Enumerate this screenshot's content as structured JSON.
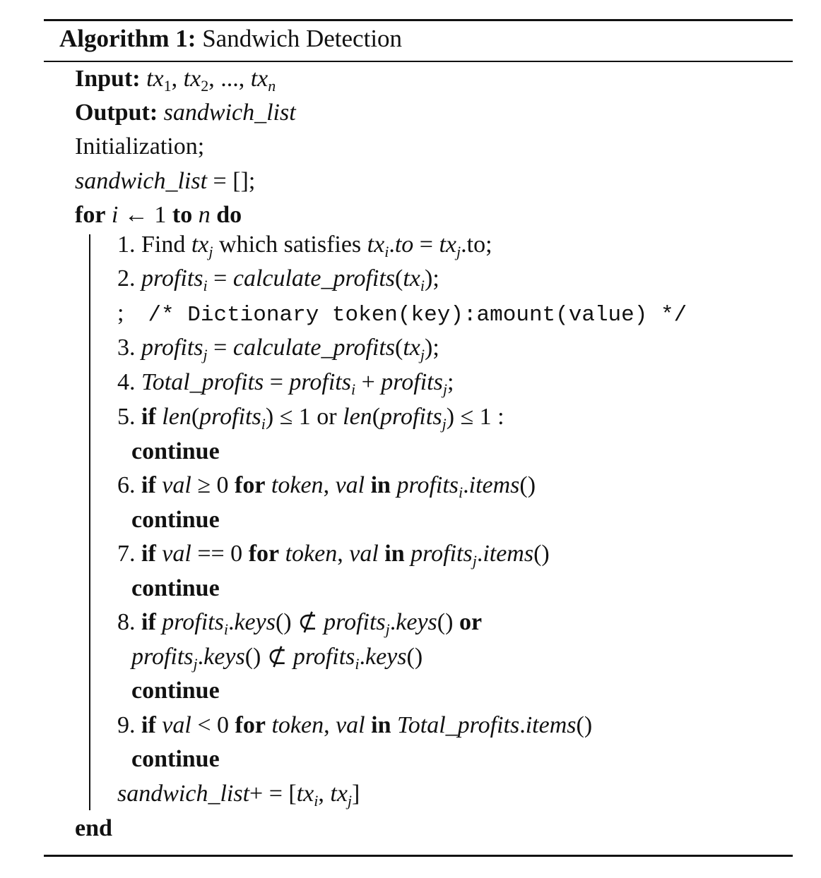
{
  "caption": {
    "label": "Algorithm 1:",
    "title": "Sandwich Detection"
  },
  "io": {
    "input_label": "Input:",
    "input_value": "tx1, tx2, ..., txn",
    "output_label": "Output:",
    "output_value": "sandwich_list"
  },
  "init": {
    "initialization": "Initialization;",
    "assign": "sandwich_list = [];"
  },
  "loop": {
    "header": "for i ← 1 to n do",
    "end": "end"
  },
  "steps": [
    "1. Find txj which satisfies txi.to = txj.to;",
    "2. profitsi = calculate_profits(txi);",
    "; /* Dictionary token(key):amount(value) */",
    "3. profitsj = calculate_profits(txj);",
    "4. Total_profits = profitsi + profitsj;",
    "5. if len(profitsi) ≤ 1 or len(profitsj) ≤ 1 :",
    "continue",
    "6. if val ≥ 0 for token, val in profitsi.items()",
    "continue",
    "7. if val == 0 for token, val in profitsj.items()",
    "continue",
    "8. if profitsi.keys() ⊄ profitsj.keys() or",
    "profitsj.keys() ⊄ profitsi.keys()",
    "continue",
    "9. if val < 0 for token, val in Total_profits.items()",
    "continue",
    "sandwich_list+ = [txi, txj]"
  ]
}
